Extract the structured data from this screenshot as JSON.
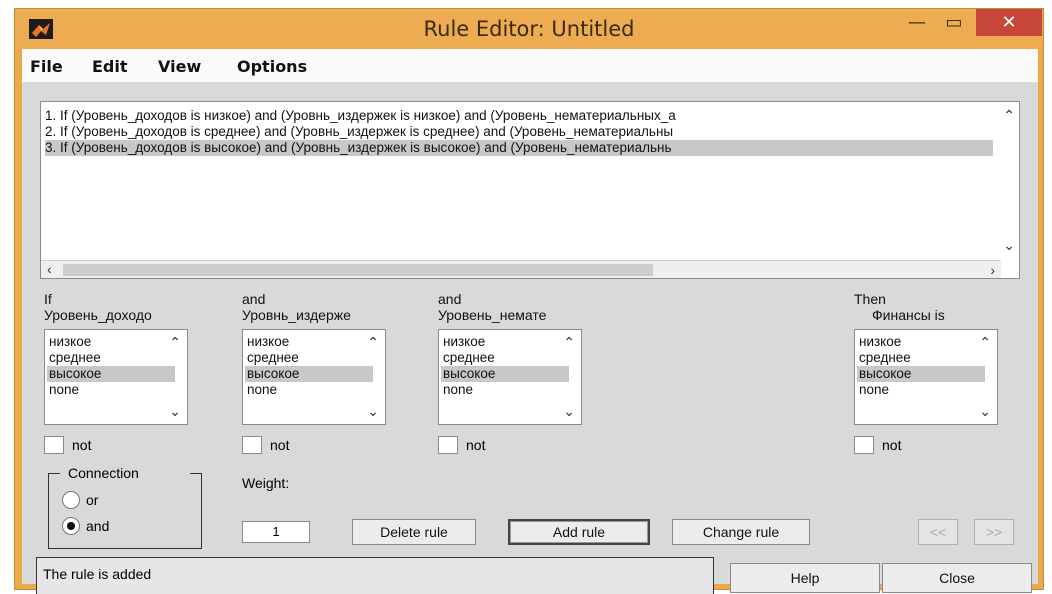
{
  "window": {
    "title": "Rule Editor: Untitled",
    "buttons": {
      "minimize": "—",
      "maximize": "▭",
      "close": "✕"
    },
    "close_button_color": "#c7463a",
    "title_bar_color": "#eeac52"
  },
  "menu": {
    "items": [
      {
        "label": "File"
      },
      {
        "label": "Edit"
      },
      {
        "label": "View"
      },
      {
        "label": "Options"
      }
    ]
  },
  "rules": {
    "items": [
      {
        "text": "1. If (Уровень_доходов is низкое) and (Уровнь_издержек is низкое) and (Уровень_нематериальных_а"
      },
      {
        "text": "2. If (Уровень_доходов is среднее) and (Уровнь_издержек is среднее) and (Уровень_нематериальны"
      },
      {
        "text": "3. If (Уровень_доходов is высокое) and (Уровнь_издержек is высокое) and (Уровень_нематериальнь"
      }
    ],
    "selected_index": 2
  },
  "inputs": [
    {
      "connector": "If",
      "name": "Уровень_доходо",
      "options": [
        "низкое",
        "среднее",
        "высокое",
        "none"
      ],
      "selected": "высокое",
      "not_label": "not"
    },
    {
      "connector": "and",
      "name": "Уровнь_издерже",
      "options": [
        "низкое",
        "среднее",
        "высокое",
        "none"
      ],
      "selected": "высокое",
      "not_label": "not"
    },
    {
      "connector": "and",
      "name": "Уровень_немате",
      "options": [
        "низкое",
        "среднее",
        "высокое",
        "none"
      ],
      "selected": "высокое",
      "not_label": "not"
    }
  ],
  "output": {
    "connector": "Then",
    "name": "Финансы is",
    "options": [
      "низкое",
      "среднее",
      "высокое",
      "none"
    ],
    "selected": "высокое",
    "not_label": "not"
  },
  "connection": {
    "label": "Connection",
    "options": [
      "or",
      "and"
    ],
    "selected": "and"
  },
  "weight": {
    "label": "Weight:",
    "value": "1"
  },
  "buttons": {
    "delete": "Delete rule",
    "add": "Add rule",
    "change": "Change rule",
    "prev": "<<",
    "next": ">>",
    "help": "Help",
    "close": "Close"
  },
  "status": {
    "text": "The rule is added"
  }
}
